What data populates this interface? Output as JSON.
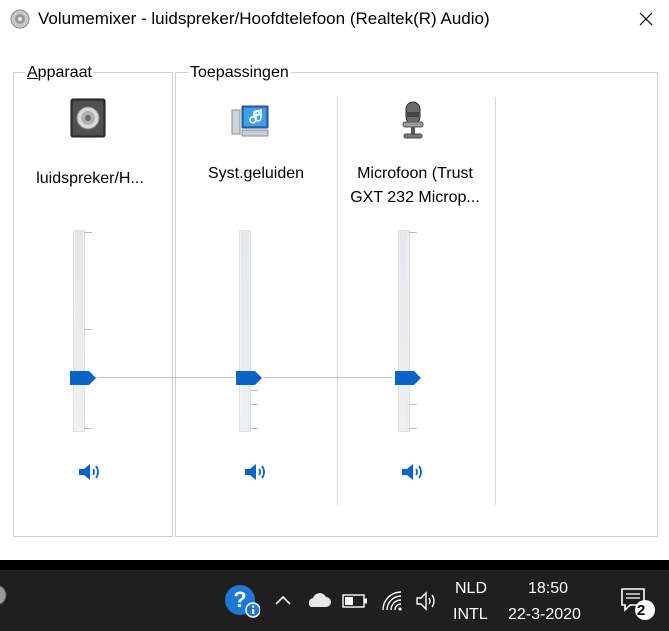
{
  "window": {
    "title": "Volumemixer - luidspreker/Hoofdtelefoon (Realtek(R) Audio)",
    "close_glyph": "✕"
  },
  "device_section": {
    "legend_first": "A",
    "legend_rest": "pparaat",
    "channel": {
      "label": "luidspreker/H...",
      "icon": "speaker-device-icon",
      "volume_percent": 26,
      "mute_icon": "speaker-volume-icon"
    }
  },
  "apps_section": {
    "legend": "Toepassingen",
    "channels": [
      {
        "label_line1": "Syst.geluiden",
        "label_line2": "",
        "icon": "system-sounds-icon",
        "volume_percent": 26,
        "mute_icon": "speaker-volume-icon"
      },
      {
        "label_line1": "Microfoon (Trust",
        "label_line2": "GXT 232 Microp...",
        "icon": "microphone-icon",
        "volume_percent": 26,
        "mute_icon": "speaker-volume-icon"
      }
    ]
  },
  "taskbar": {
    "language_top": "NLD",
    "language_bottom": "INTL",
    "time": "18:50",
    "date": "22-3-2020",
    "notification_count": "2",
    "icons": [
      "help-icon",
      "chevron-up-icon",
      "onedrive-icon",
      "battery-icon",
      "wifi-icon",
      "volume-icon",
      "action-center-icon"
    ],
    "colors": {
      "background": "#1f1f1f",
      "help_icon": "#1e78d6"
    }
  }
}
